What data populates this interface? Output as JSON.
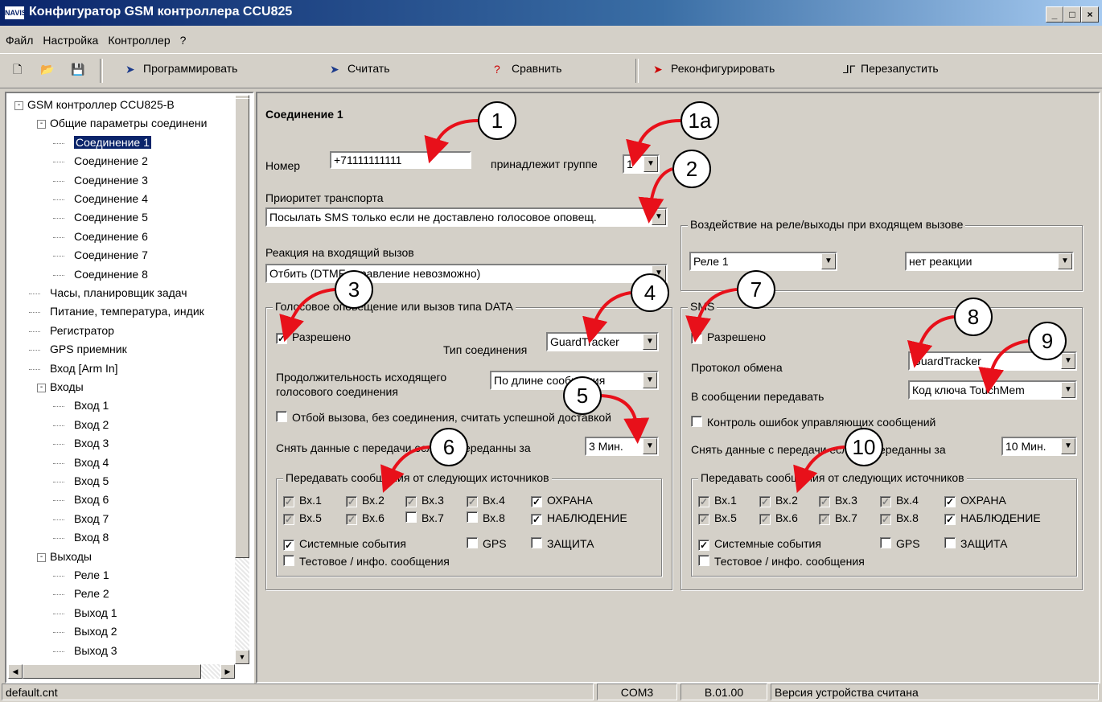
{
  "window": {
    "title": "Конфигуратор GSM контроллера CCU825",
    "app_icon": "NAVIS",
    "min": "_",
    "max": "□",
    "close": "×"
  },
  "menu": [
    "Файл",
    "Настройка",
    "Контроллер",
    "?"
  ],
  "toolbar": {
    "program": "Программировать",
    "read": "Считать",
    "compare": "Сравнить",
    "reconfigure": "Реконфигурировать",
    "restart": "Перезапустить"
  },
  "tree": [
    {
      "label": "GSM контроллер CCU825-B",
      "level": 0,
      "exp": "-"
    },
    {
      "label": "Общие параметры соединени",
      "level": 1,
      "exp": "-"
    },
    {
      "label": "Соединение 1",
      "level": 2,
      "selected": true
    },
    {
      "label": "Соединение 2",
      "level": 2
    },
    {
      "label": "Соединение 3",
      "level": 2
    },
    {
      "label": "Соединение 4",
      "level": 2
    },
    {
      "label": "Соединение 5",
      "level": 2
    },
    {
      "label": "Соединение 6",
      "level": 2
    },
    {
      "label": "Соединение 7",
      "level": 2
    },
    {
      "label": "Соединение 8",
      "level": 2
    },
    {
      "label": "Часы, планировщик задач",
      "level": 1
    },
    {
      "label": "Питание, температура, индик",
      "level": 1
    },
    {
      "label": "Регистратор",
      "level": 1
    },
    {
      "label": "GPS приемник",
      "level": 1
    },
    {
      "label": "Вход [Arm In]",
      "level": 1
    },
    {
      "label": "Входы",
      "level": 1,
      "exp": "-"
    },
    {
      "label": "Вход 1",
      "level": 2
    },
    {
      "label": "Вход 2",
      "level": 2
    },
    {
      "label": "Вход 3",
      "level": 2
    },
    {
      "label": "Вход 4",
      "level": 2
    },
    {
      "label": "Вход 5",
      "level": 2
    },
    {
      "label": "Вход 6",
      "level": 2
    },
    {
      "label": "Вход 7",
      "level": 2
    },
    {
      "label": "Вход 8",
      "level": 2
    },
    {
      "label": "Выходы",
      "level": 1,
      "exp": "-"
    },
    {
      "label": "Реле 1",
      "level": 2
    },
    {
      "label": "Реле 2",
      "level": 2
    },
    {
      "label": "Выход 1",
      "level": 2
    },
    {
      "label": "Выход 2",
      "level": 2
    },
    {
      "label": "Выход 3",
      "level": 2
    }
  ],
  "main": {
    "heading": "Соединение 1",
    "number_label": "Номер",
    "number_value": "+71111111111",
    "group_label": "принадлежит группе",
    "group_value": "1",
    "priority_label": "Приоритет транспорта",
    "priority_value": "Посылать SMS только если не доставлено голосовое оповещ.",
    "incoming_label": "Реакция на входящий вызов",
    "incoming_value": "Отбить (DTMF управление невозможно)",
    "relay_group_title": "Воздействие на реле/выходы при входящем вызове",
    "relay_value": "Реле 1",
    "relay_reaction": "нет реакции",
    "voice": {
      "title": "Голосовое оповещение или вызов типа DATA",
      "enabled_label": "Разрешено",
      "conn_type_label": "Тип соединения",
      "conn_type_value": "GuardTracker",
      "duration_label_1": "Продолжительность исходящего",
      "duration_label_2": "голосового соединения",
      "duration_value": "По длине сообщения",
      "hangup_label": "Отбой вызова, без соединения, считать успешной доставкой",
      "remove_label": "Снять данные с передачи если не переданны за",
      "remove_value": "3 Мин.",
      "sources_title": "Передавать сообщения от следующих источников",
      "in1": "Вх.1",
      "in2": "Вх.2",
      "in3": "Вх.3",
      "in4": "Вх.4",
      "in5": "Вх.5",
      "in6": "Вх.6",
      "in7": "Вх.7",
      "in8": "Вх.8",
      "guard": "ОХРАНА",
      "observe": "НАБЛЮДЕНИЕ",
      "system": "Системные события",
      "gps": "GPS",
      "protect": "ЗАЩИТА",
      "test": "Тестовое / инфо. сообщения"
    },
    "sms": {
      "title": "SMS",
      "enabled_label": "Разрешено",
      "protocol_label": "Протокол обмена",
      "protocol_value": "GuardTracker",
      "send_label": "В сообщении передавать",
      "send_value": "Код ключа TouchMem",
      "errctl_label": "Контроль ошибок управляющих сообщений",
      "remove_label": "Снять данные с передачи если не переданны за",
      "remove_value": "10 Мин.",
      "sources_title": "Передавать сообщения от следующих источников",
      "in1": "Вх.1",
      "in2": "Вх.2",
      "in3": "Вх.3",
      "in4": "Вх.4",
      "in5": "Вх.5",
      "in6": "Вх.6",
      "in7": "Вх.7",
      "in8": "Вх.8",
      "guard": "ОХРАНА",
      "observe": "НАБЛЮДЕНИЕ",
      "system": "Системные события",
      "gps": "GPS",
      "protect": "ЗАЩИТА",
      "test": "Тестовое / инфо. сообщения"
    }
  },
  "callouts": [
    "1",
    "1a",
    "2",
    "3",
    "4",
    "5",
    "6",
    "7",
    "8",
    "9",
    "10"
  ],
  "status": {
    "file": "default.cnt",
    "port": "COM3",
    "version": "B.01.00",
    "message": "Версия устройства считана"
  },
  "colors": {
    "face": "#d4d0c8",
    "title_start": "#0a246a",
    "selection": "#0a246a",
    "arrow": "#e8101a"
  }
}
